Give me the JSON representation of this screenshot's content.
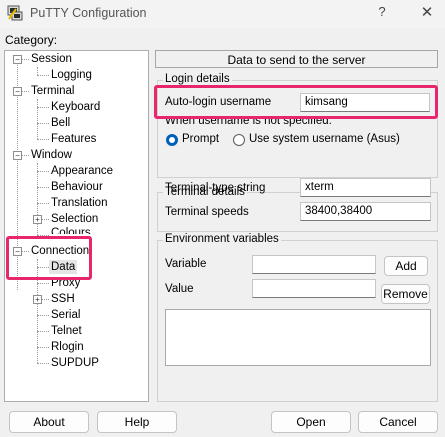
{
  "window": {
    "title": "PuTTY Configuration",
    "help_glyph": "?",
    "close_glyph": "✕"
  },
  "category_label": "Category:",
  "tree": {
    "session": "Session",
    "logging": "Logging",
    "terminal": "Terminal",
    "keyboard": "Keyboard",
    "bell": "Bell",
    "features": "Features",
    "window": "Window",
    "appearance": "Appearance",
    "behaviour": "Behaviour",
    "translation": "Translation",
    "selection": "Selection",
    "colours": "Colours",
    "connection": "Connection",
    "data": "Data",
    "proxy": "Proxy",
    "ssh": "SSH",
    "serial": "Serial",
    "telnet": "Telnet",
    "rlogin": "Rlogin",
    "supdup": "SUPDUP",
    "selected": "Data"
  },
  "panel": {
    "header": "Data to send to the server",
    "login": {
      "group_title": "Login details",
      "autologin_label": "Auto-login username",
      "autologin_value": "kimsang",
      "when_not_specified": "When username is not specified:",
      "prompt_label": "Prompt",
      "use_system_label": "Use system username (Asus)",
      "selected_option": "Prompt"
    },
    "terminal": {
      "group_title": "Terminal details",
      "type_label": "Terminal-type string",
      "type_value": "xterm",
      "speeds_label": "Terminal speeds",
      "speeds_value": "38400,38400"
    },
    "env": {
      "group_title": "Environment variables",
      "variable_label": "Variable",
      "variable_value": "",
      "value_label": "Value",
      "value_value": "",
      "add_button": "Add",
      "remove_button": "Remove"
    }
  },
  "buttons": {
    "about": "About",
    "help": "Help",
    "open": "Open",
    "cancel": "Cancel"
  },
  "highlight_color": "#e8266d",
  "accent_color": "#005fb8"
}
